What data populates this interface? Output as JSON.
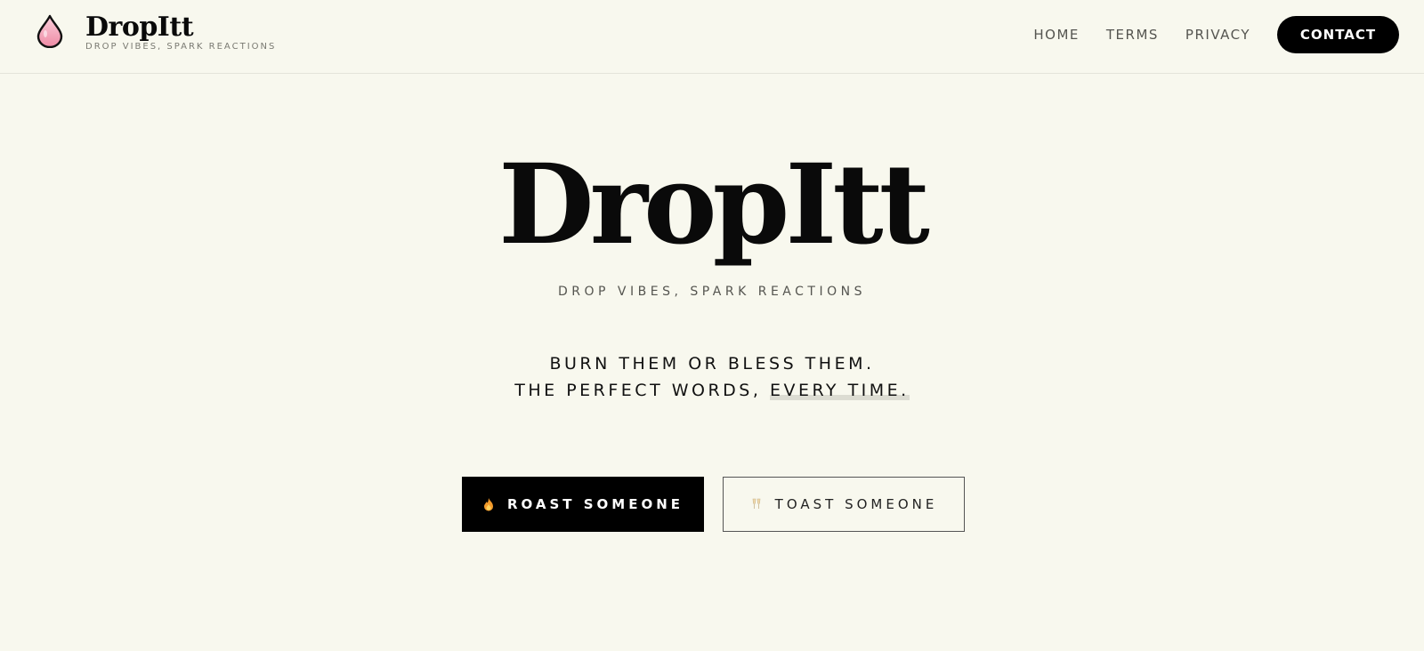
{
  "header": {
    "brand_name": "DropItt",
    "brand_tagline": "DROP VIBES, SPARK REACTIONS",
    "logo_icon": "droplet-icon",
    "nav": [
      {
        "label": "HOME"
      },
      {
        "label": "TERMS"
      },
      {
        "label": "PRIVACY"
      }
    ],
    "contact_label": "CONTACT"
  },
  "hero": {
    "title": "DropItt",
    "tagline": "DROP VIBES, SPARK REACTIONS",
    "line1": "BURN THEM OR BLESS THEM.",
    "line2_prefix": "THE PERFECT WORDS, ",
    "line2_highlight": "EVERY TIME.",
    "roast_label": "ROAST SOMEONE",
    "roast_icon": "fire-icon",
    "toast_label": "TOAST SOMEONE",
    "toast_icon": "champagne-icon"
  },
  "colors": {
    "background": "#f8f8ee",
    "primary": "#000000",
    "logo_pink": "#f4a0b4"
  }
}
